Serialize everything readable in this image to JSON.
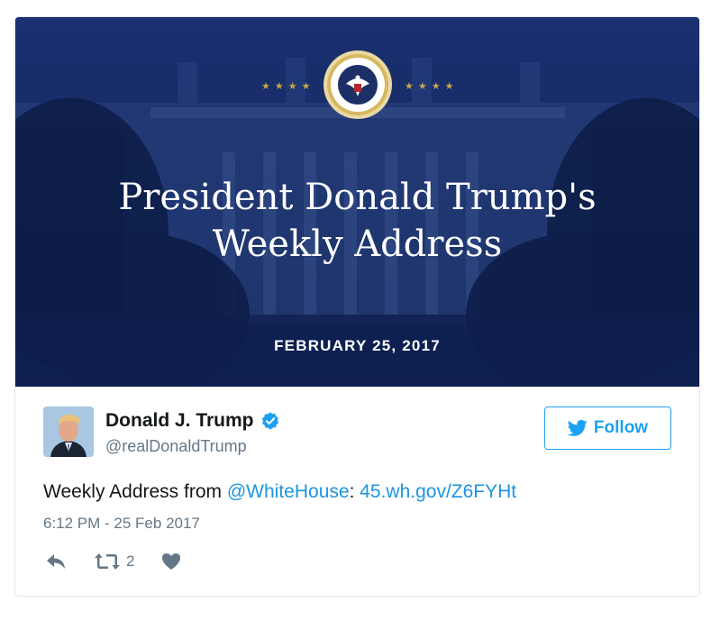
{
  "media": {
    "headline_line1": "President Donald Trump's",
    "headline_line2": "Weekly Address",
    "date": "FEBRUARY 25, 2017",
    "stars_left": "★★★★",
    "stars_right": "★★★★",
    "seal_icon": "presidential-seal-icon",
    "background_color": "#13285c"
  },
  "author": {
    "name": "Donald J. Trump",
    "handle": "@realDonaldTrump",
    "verified": true
  },
  "follow": {
    "label": "Follow",
    "color": "#1da1f2"
  },
  "tweet": {
    "text_prefix": "Weekly Address from ",
    "mention": "@WhiteHouse",
    "separator": ": ",
    "link": "45.wh.gov/Z6FYHt",
    "link_color": "#1b95e0"
  },
  "timestamp": "6:12 PM - 25 Feb 2017",
  "actions": {
    "retweet_count": "2"
  }
}
